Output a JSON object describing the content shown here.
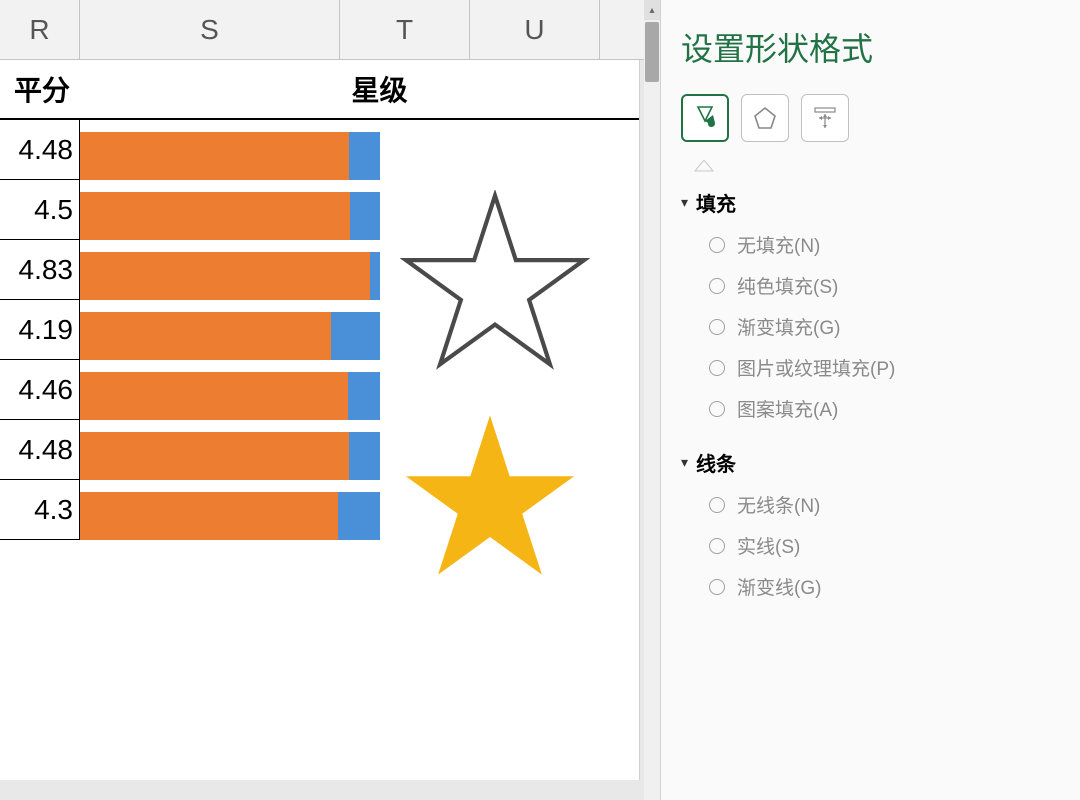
{
  "columns": {
    "r": "R",
    "s": "S",
    "t": "T",
    "u": "U"
  },
  "headers": {
    "score": "平分",
    "stars": "星级"
  },
  "panel": {
    "title": "设置形状格式",
    "fill": {
      "title": "填充",
      "options": {
        "none": "无填充(N)",
        "solid": "纯色填充(S)",
        "gradient": "渐变填充(G)",
        "picture": "图片或纹理填充(P)",
        "pattern": "图案填充(A)"
      }
    },
    "line": {
      "title": "线条",
      "options": {
        "none": "无线条(N)",
        "solid": "实线(S)",
        "gradient": "渐变线(G)"
      }
    }
  },
  "chart_data": {
    "type": "bar",
    "categories": [
      "4.48",
      "4.5",
      "4.83",
      "4.19",
      "4.46",
      "4.48",
      "4.3"
    ],
    "series": [
      {
        "name": "orange",
        "color": "#ed7d31",
        "values": [
          4.48,
          4.5,
          4.83,
          4.19,
          4.46,
          4.48,
          4.3
        ]
      },
      {
        "name": "blue",
        "color": "#4a90d9",
        "values": [
          5,
          5,
          5,
          5,
          5,
          5,
          5
        ]
      }
    ],
    "xlim": [
      0,
      5
    ],
    "title": "星级",
    "ylabel": "平分"
  },
  "colors": {
    "orange": "#ed7d31",
    "blue": "#4a90d9",
    "accent": "#217346",
    "star_fill": "#f5b515"
  }
}
